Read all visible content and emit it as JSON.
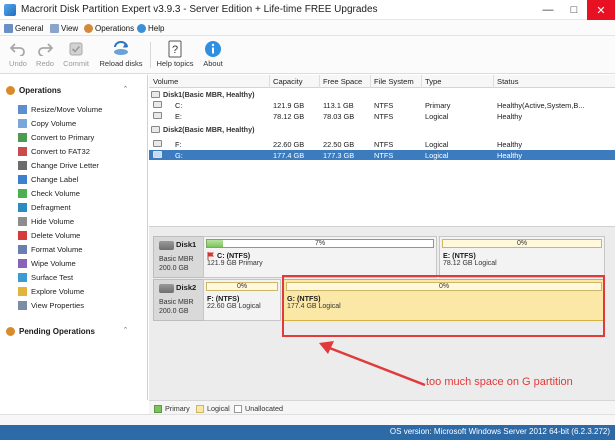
{
  "window": {
    "title": "Macrorit Disk Partition Expert v3.9.3 - Server Edition + Life-time FREE Upgrades"
  },
  "menu": [
    {
      "label": "General",
      "key": "G"
    },
    {
      "label": "View",
      "key": "V"
    },
    {
      "label": "Operations",
      "key": "O"
    },
    {
      "label": "Help",
      "key": "H"
    }
  ],
  "toolbar": {
    "undo": "Undo",
    "redo": "Redo",
    "commit": "Commit",
    "reload": "Reload disks",
    "help_topics": "Help topics",
    "about": "About"
  },
  "sidebar": {
    "operations_title": "Operations",
    "pending_title": "Pending Operations",
    "items": [
      "Resize/Move Volume",
      "Copy Volume",
      "Convert to Primary",
      "Convert to FAT32",
      "Change Drive Letter",
      "Change Label",
      "Check Volume",
      "Defragment",
      "Hide Volume",
      "Delete Volume",
      "Format Volume",
      "Wipe Volume",
      "Surface Test",
      "Explore Volume",
      "View Properties"
    ]
  },
  "table": {
    "columns": [
      "Volume",
      "Capacity",
      "Free Space",
      "File System",
      "Type",
      "Status"
    ],
    "disk1_label": "Disk1(Basic MBR, Healthy)",
    "disk2_label": "Disk2(Basic MBR, Healthy)",
    "rows": [
      {
        "volume": "C:",
        "capacity": "121.9 GB",
        "free": "113.1 GB",
        "fs": "NTFS",
        "type": "Primary",
        "status": "Healthy(Active,System,B..."
      },
      {
        "volume": "E:",
        "capacity": "78.12 GB",
        "free": "78.03 GB",
        "fs": "NTFS",
        "type": "Logical",
        "status": "Healthy"
      },
      {
        "volume": "F:",
        "capacity": "22.60 GB",
        "free": "22.50 GB",
        "fs": "NTFS",
        "type": "Logical",
        "status": "Healthy"
      },
      {
        "volume": "G:",
        "capacity": "177.4 GB",
        "free": "177.3 GB",
        "fs": "NTFS",
        "type": "Logical",
        "status": "Healthy"
      }
    ],
    "splitter": "....."
  },
  "map": {
    "disk1": {
      "name": "Disk1",
      "type": "Basic MBR",
      "size": "200.0 GB"
    },
    "disk2": {
      "name": "Disk2",
      "type": "Basic MBR",
      "size": "200.0 GB"
    },
    "c": {
      "pct_label": "7%",
      "pct": 7,
      "name": "C: (NTFS)",
      "desc": "121.9 GB Primary"
    },
    "e": {
      "pct_label": "0%",
      "pct": 0,
      "name": "E: (NTFS)",
      "desc": "78.12 GB Logical"
    },
    "f": {
      "pct_label": "0%",
      "pct": 0,
      "name": "F: (NTFS)",
      "desc": "22.60 GB Logical"
    },
    "g": {
      "pct_label": "0%",
      "pct": 0,
      "name": "G: (NTFS)",
      "desc": "177.4 GB Logical"
    }
  },
  "annotation": "too much space on G partition",
  "legend": {
    "primary": "Primary",
    "logical": "Logical",
    "unallocated": "Unallocated"
  },
  "status": {
    "text": "OS version: Microsoft Windows Server 2012  64-bit  (6.2.3.272)"
  },
  "colors": {
    "accent": "#2c6aa8",
    "selection": "#3d7bbf",
    "annotation": "#e03a3a",
    "primary_fill": "#7dc35c",
    "logical": "#fbe7a6"
  }
}
